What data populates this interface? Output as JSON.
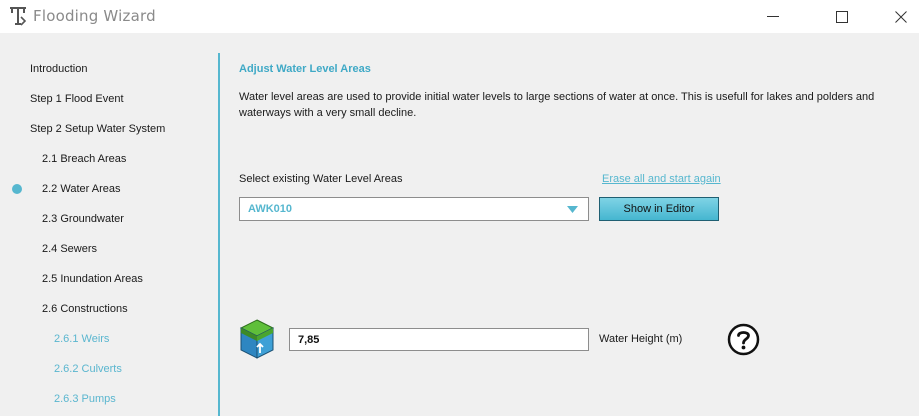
{
  "window": {
    "title": "Flooding Wizard",
    "app_icon": "tygron-logo-icon",
    "controls": [
      "minimize-icon",
      "maximize-icon",
      "close-icon"
    ]
  },
  "sidebar": {
    "items": [
      {
        "label": "Introduction",
        "level": 0,
        "active": false
      },
      {
        "label": "Step 1 Flood Event",
        "level": 0,
        "active": false
      },
      {
        "label": "Step 2 Setup Water System",
        "level": 0,
        "active": false
      },
      {
        "label": "2.1 Breach Areas",
        "level": 1,
        "active": false
      },
      {
        "label": "2.2 Water Areas",
        "level": 1,
        "active": true
      },
      {
        "label": "2.3 Groundwater",
        "level": 1,
        "active": false
      },
      {
        "label": "2.4 Sewers",
        "level": 1,
        "active": false
      },
      {
        "label": "2.5 Inundation Areas",
        "level": 1,
        "active": false
      },
      {
        "label": "2.6 Constructions",
        "level": 1,
        "active": false
      },
      {
        "label": "2.6.1 Weirs",
        "level": 2,
        "active": false
      },
      {
        "label": "2.6.2 Culverts",
        "level": 2,
        "active": false
      },
      {
        "label": "2.6.3 Pumps",
        "level": 2,
        "active": false
      }
    ],
    "active_color": "#56b7cf"
  },
  "main": {
    "title": "Adjust Water Level Areas",
    "description": "Water level areas are used to provide initial water levels to large sections of water at once. This is usefull for lakes and polders and waterways with a very small decline.",
    "select_label": "Select existing Water Level Areas",
    "erase_link": "Erase all and start again",
    "dropdown": {
      "selected": "AWK010",
      "icon": "chevron-down-icon"
    },
    "show_editor_button": "Show in Editor",
    "water_height": {
      "value": "7,85",
      "label": "Water Height (m)",
      "icon": "water-level-cube-icon",
      "help_icon": "help-icon"
    }
  },
  "colors": {
    "accent": "#56b7cf",
    "link": "#56b7cf",
    "button": "#45b6d0"
  }
}
